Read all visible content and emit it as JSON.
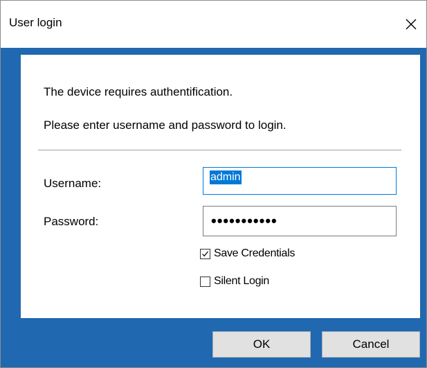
{
  "window": {
    "title": "User login",
    "close_glyph": "close-icon"
  },
  "messages": {
    "line1": "The device requires authentification.",
    "line2": "Please enter username and password to login."
  },
  "form": {
    "username_label": "Username:",
    "username_value": "admin",
    "password_label": "Password:",
    "password_masked": "•••••••••••",
    "save_credentials": {
      "label": "Save Credentials",
      "checked": true
    },
    "silent_login": {
      "label": "Silent Login",
      "checked": false
    }
  },
  "buttons": {
    "ok_label": "OK",
    "cancel_label": "Cancel"
  },
  "colors": {
    "frame_blue": "#2068b0",
    "focus_blue": "#0078d7",
    "button_face": "#e1e1e1"
  }
}
